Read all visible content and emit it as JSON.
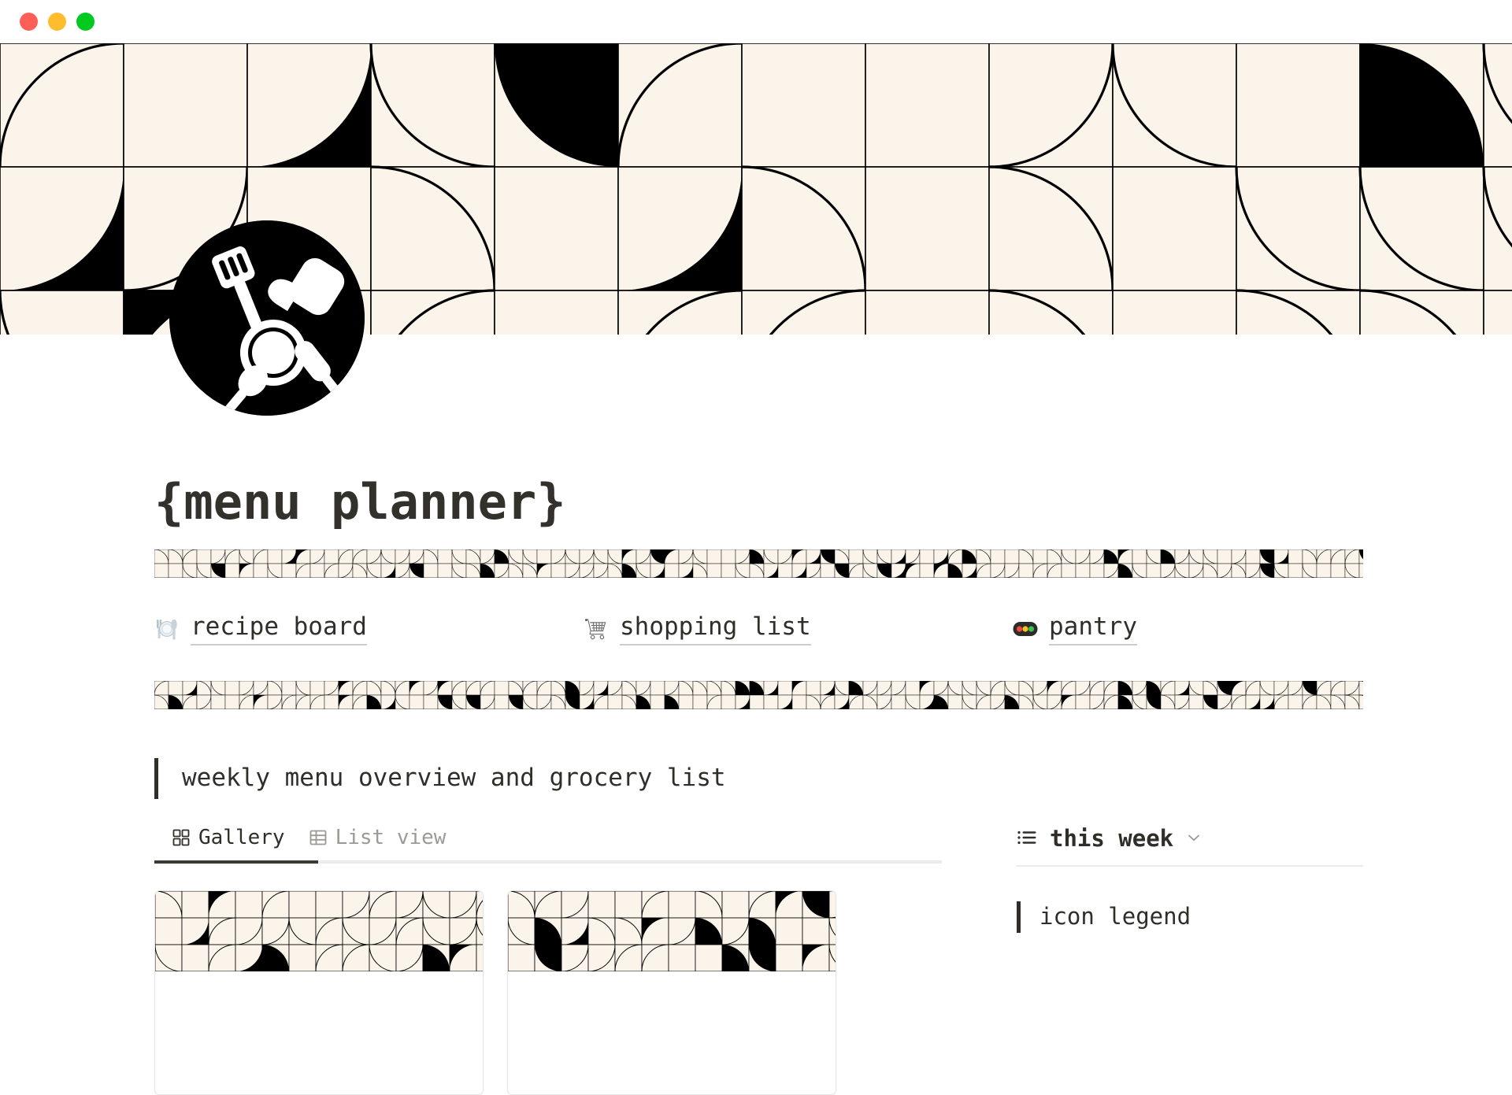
{
  "window": {
    "traffic_lights": [
      {
        "name": "close",
        "color": "#ff5f57"
      },
      {
        "name": "minimize",
        "color": "#ffbd2e"
      },
      {
        "name": "maximize",
        "color": "#00ca1f"
      }
    ]
  },
  "hero": {
    "pattern_name": "quarter-circle-tile-pattern",
    "background_color": "#faf4ea",
    "ink_color": "#000000",
    "avatar_icon": "cooking-utensils-icon"
  },
  "page": {
    "title": "{menu planner}"
  },
  "nav": {
    "links": [
      {
        "icon": "plate-with-cutlery-icon",
        "label": "recipe board"
      },
      {
        "icon": "shopping-cart-icon",
        "label": "shopping list"
      },
      {
        "icon": "traffic-light-icon",
        "label": "pantry"
      }
    ]
  },
  "callout": {
    "text": "weekly menu overview and grocery list"
  },
  "main": {
    "tabs": [
      {
        "icon": "gallery-grid-icon",
        "label": "Gallery",
        "active": true
      },
      {
        "icon": "table-grid-icon",
        "label": "List view",
        "active": false
      }
    ],
    "cards": [
      {
        "cover": "quarter-circle-tile-pattern"
      },
      {
        "cover": "quarter-circle-tile-pattern"
      }
    ]
  },
  "sidebar": {
    "header": {
      "icon": "bulleted-list-icon",
      "label": "this week",
      "chevron": "chevron-down-icon"
    },
    "callout": {
      "text": "icon legend"
    }
  },
  "colors": {
    "cream": "#faf4ea",
    "ink": "#000000",
    "text": "#2f2e29",
    "muted": "#9b9a96",
    "rule": "#eceaea",
    "underline": "#cfcdc8"
  }
}
